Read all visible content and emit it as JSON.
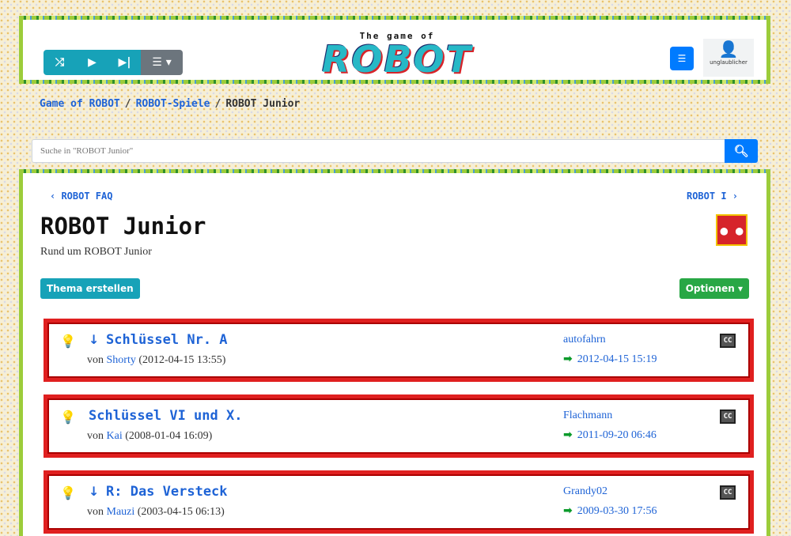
{
  "player": {
    "shuffle_icon": "shuffle-icon",
    "play_icon": "play-icon",
    "next_icon": "skip-next-icon",
    "list_icon": "list-icon"
  },
  "logo": {
    "small": "The game of",
    "big": "ROBOT"
  },
  "user": {
    "name": "unglaublicher"
  },
  "breadcrumb": [
    {
      "label": "Game of ROBOT"
    },
    {
      "label": "ROBOT-Spiele"
    },
    {
      "label": "ROBOT Junior"
    }
  ],
  "search": {
    "placeholder": "Suche in \"ROBOT Junior\""
  },
  "nav": {
    "prev": "‹ ROBOT FAQ",
    "next": "ROBOT I ›"
  },
  "forum": {
    "title": "ROBOT Junior",
    "subtitle": "Rund um ROBOT Junior",
    "icon_label": "● ●"
  },
  "buttons": {
    "create": "Thema erstellen",
    "options": "Optionen ▾"
  },
  "topics": [
    {
      "title": "Schlüssel Nr. A",
      "has_arrow": true,
      "by": "von",
      "author": "Shorty",
      "created": "(2012-04-15 13:55)",
      "last_user": "autofahrn",
      "last_date": "2012-04-15 15:19"
    },
    {
      "title": "Schlüssel VI und X.",
      "has_arrow": false,
      "by": "von",
      "author": "Kai",
      "created": "(2008-01-04 16:09)",
      "last_user": "Flachmann",
      "last_date": "2011-09-20 06:46"
    },
    {
      "title": "R: Das Versteck",
      "has_arrow": true,
      "by": "von",
      "author": "Mauzi",
      "created": "(2003-04-15 06:13)",
      "last_user": "Grandy02",
      "last_date": "2009-03-30 17:56"
    }
  ],
  "colors": {
    "accent_blue": "#007bff",
    "link_blue": "#1e63d6",
    "teal": "#17a2b8",
    "green": "#28a745",
    "topic_border": "#e02020"
  }
}
